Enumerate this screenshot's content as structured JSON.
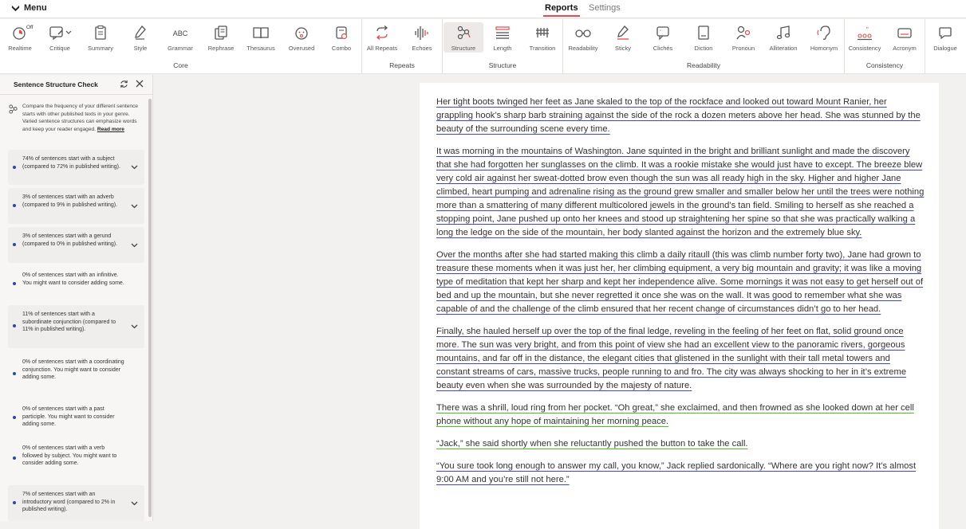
{
  "header": {
    "menu_label": "Menu",
    "tabs": [
      {
        "label": "Reports",
        "active": true
      },
      {
        "label": "Settings",
        "active": false
      }
    ]
  },
  "toolbar": {
    "tools": [
      {
        "label": "Realtime",
        "badge": "Off",
        "icon": "timer-icon"
      },
      {
        "label": "Critique",
        "icon": "critique-icon"
      },
      {
        "label": "Summary",
        "icon": "clipboard-icon"
      },
      {
        "label": "Style",
        "icon": "pen-icon"
      },
      {
        "label": "Grammar",
        "icon": "abc-icon",
        "glyph": "ABC"
      },
      {
        "label": "Rephrase",
        "icon": "rephrase-icon"
      },
      {
        "label": "Thesaurus",
        "icon": "book-icon"
      },
      {
        "label": "Overused",
        "icon": "face-icon"
      },
      {
        "label": "Combo",
        "icon": "combo-icon"
      },
      {
        "label": "All Repeats",
        "icon": "repeat-icon"
      },
      {
        "label": "Echoes",
        "icon": "echo-icon"
      },
      {
        "label": "Structure",
        "icon": "structure-icon",
        "active": true
      },
      {
        "label": "Length",
        "icon": "length-icon"
      },
      {
        "label": "Transition",
        "icon": "transition-icon"
      },
      {
        "label": "Readability",
        "icon": "glasses-icon"
      },
      {
        "label": "Sticky",
        "icon": "sticky-icon"
      },
      {
        "label": "Clichés",
        "icon": "cliche-icon"
      },
      {
        "label": "Diction",
        "icon": "diction-icon"
      },
      {
        "label": "Pronoun",
        "icon": "pronoun-icon"
      },
      {
        "label": "Alliteration",
        "icon": "music-icon"
      },
      {
        "label": "Homonym",
        "icon": "ear-icon"
      },
      {
        "label": "Consistency",
        "icon": "consistency-icon"
      },
      {
        "label": "Acronym",
        "icon": "acronym-icon"
      },
      {
        "label": "Dialogue",
        "icon": "dialogue-icon"
      }
    ],
    "groups": [
      "Core",
      "Repeats",
      "Structure",
      "Readability",
      "Consistency"
    ]
  },
  "sidebar": {
    "title": "Sentence Structure Check",
    "description": "Compare the frequency of your different sentence starts with other published texts in your genre. Varied sentence structures can emphasize words and keep your reader engaged.",
    "read_more": "Read more",
    "items": [
      {
        "text": "74% of sentences start with a subject (compared to 72% in published writing).",
        "expandable": true
      },
      {
        "text": "3% of sentences start with an adverb (compared to 9% in published writing).",
        "expandable": true
      },
      {
        "text": "3% of sentences start with a gerund (compared to 0% in published writing).",
        "expandable": true
      },
      {
        "text": "0% of sentences start with an infinitive. You might want to consider adding some.",
        "expandable": false
      },
      {
        "text": "11% of sentences start with a subordinate conjunction (compared to 11% in published writing).",
        "expandable": true
      },
      {
        "text": "0% of sentences start with a coordinating conjunction. You might want to consider adding some.",
        "expandable": false
      },
      {
        "text": "0% of sentences start with a past participle. You might want to consider adding some.",
        "expandable": false
      },
      {
        "text": "0% of sentences start with a verb followed by subject. You might want to consider adding some.",
        "expandable": false
      },
      {
        "text": "7% of sentences start with an introductory word (compared to 2% in published writing).",
        "expandable": true
      }
    ]
  },
  "document": {
    "paragraphs": [
      {
        "text": "Her tight boots twinged her feet as Jane skaled to the top of the rockface and looked out toward Mount Ranier, her grappling hook’s sharp barb straining against the side of the rock a dozen meters above her head. She was stunned by the beauty of the surrounding scene every time.",
        "underline": "blue"
      },
      {
        "text": "It was morning in the mountains of Washington. Jane squinted in the bright and brilliant sunlight and made the discovery that she had forgotten her sunglasses on the climb. It was a rookie mistake she would just have to except. The breeze blew very cold air against her sweat-dotted brow even though the sun was all ready high in the sky. Higher and higher Jane climbed, heart pumping and adrenaline rising as the ground grew smaller and smaller below her until the trees were nothing more than a smattering of many different multicolored jewels in the ground’s tan field. Smiling to herself as she reached a stopping point, Jane pushed up onto her knees and stood up straightening her spine so that she was practically walking a long the ledge on the side of the mountain, her body slanted against the horizon and the extremely blue sky.",
        "underline": "blue"
      },
      {
        "text": "Over the months after she had started making this climb a daily ritaull (this was climb number forty two), Jane had grown to treasure these moments when it was just her, her climbing equipment, a very big mountain and gravity; it was like a moving type of meditation that kept her sharp and kept her independence alive. Some mornings it was not easy to get herself out of bed and up the mountain, but she never regretted it once she was on the wall. It was good to remember what she was capable of and the challenge of the climb ensured that her recent change of circumstances didn’t go to her head.",
        "underline": "blue"
      },
      {
        "text": "Finally, she hauled herself up over the top of the final ledge, reveling in the feeling of her feet on flat, solid ground once more. The sun was very bright, and from this point of view she had an excellent view to the panoramic rivers, gorgeous mountains, and far off in the distance, the elegant cities that glistened in the sunlight with their tall metal towers and constant streams of cars, massive trucks, people running to and fro. The city was always shocking to her in it’s extreme beauty even when she was surrounded by the majesty of nature.",
        "underline": "blue"
      },
      {
        "text": "There was a shrill, loud ring from her pocket. “Oh great,” she exclaimed, and then frowned as she looked down at her cell phone without any hope of maintaining her morning peace.",
        "underline": "green"
      },
      {
        "text": "“Jack,” she said shortly when she reluctantly pushed the button to take the call.",
        "underline": "green"
      },
      {
        "text": "“You sure took long enough to answer my call, you know,” Jack replied sardonically. “Where are you right now? It’s almost 9:00 AM and you’re still not here.”",
        "underline": "blue"
      }
    ]
  },
  "colors": {
    "accent": "#e34b50",
    "blue_underline": "#3d47c9",
    "green_underline": "#4bbf2b",
    "bullet": "#2748a8"
  }
}
